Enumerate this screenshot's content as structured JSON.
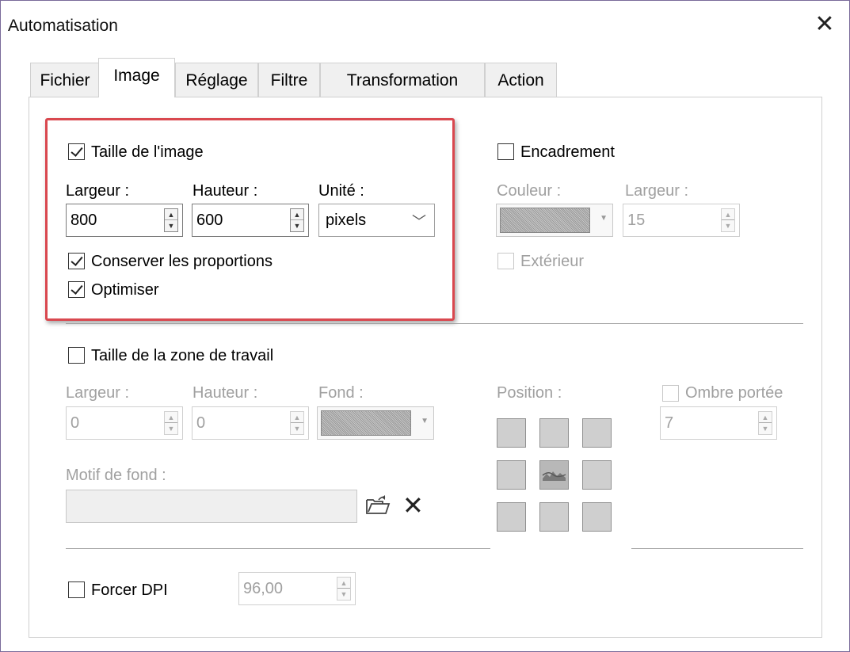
{
  "window": {
    "title": "Automatisation",
    "close_label": "✕"
  },
  "tabs": [
    {
      "label": "Fichier",
      "active": false
    },
    {
      "label": "Image",
      "active": true
    },
    {
      "label": "Réglage",
      "active": false
    },
    {
      "label": "Filtre",
      "active": false
    },
    {
      "label": "Transformation",
      "active": false
    },
    {
      "label": "Action",
      "active": false
    }
  ],
  "image_size": {
    "checkbox_label": "Taille de l'image",
    "checked": true,
    "width_label": "Largeur :",
    "width_value": "800",
    "height_label": "Hauteur :",
    "height_value": "600",
    "unit_label": "Unité :",
    "unit_value": "pixels",
    "keep_ratio_label": "Conserver les proportions",
    "keep_ratio_checked": true,
    "optimize_label": "Optimiser",
    "optimize_checked": true
  },
  "frame": {
    "checkbox_label": "Encadrement",
    "checked": false,
    "color_label": "Couleur :",
    "width_label": "Largeur :",
    "width_value": "15",
    "outside_label": "Extérieur",
    "outside_checked": false
  },
  "canvas": {
    "checkbox_label": "Taille de la zone de travail",
    "checked": false,
    "width_label": "Largeur :",
    "width_value": "0",
    "height_label": "Hauteur :",
    "height_value": "0",
    "background_label": "Fond :",
    "position_label": "Position :",
    "shadow_label": "Ombre portée",
    "shadow_checked": false,
    "shadow_value": "7",
    "pattern_label": "Motif de fond :",
    "pattern_value": ""
  },
  "dpi": {
    "checkbox_label": "Forcer DPI",
    "checked": false,
    "value": "96,00"
  },
  "colors": {
    "highlight_border": "#d9484f",
    "disabled_text": "#a0a0a0"
  },
  "icons": [
    "close-icon",
    "checkbox-icon",
    "spin-arrows-icon",
    "chevron-down-icon",
    "folder-open-icon",
    "clear-x-icon"
  ]
}
